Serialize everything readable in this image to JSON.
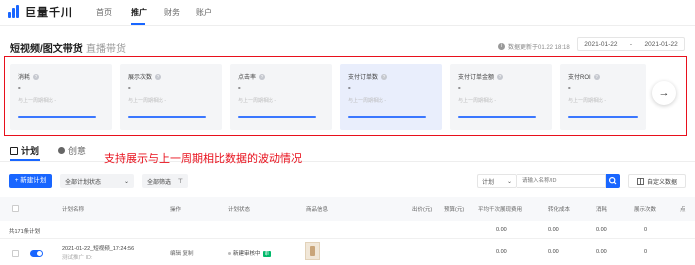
{
  "nav": {
    "logo_text": "巨量千川",
    "items": [
      {
        "label": "首页",
        "active": false
      },
      {
        "label": "推广",
        "active": true
      },
      {
        "label": "财务",
        "active": false
      },
      {
        "label": "账户",
        "active": false
      }
    ]
  },
  "content_tabs": {
    "active": "短视频/图文带货",
    "inactive": "直播带货"
  },
  "data_updated": "数据更新于01.22 18:18",
  "date_range": {
    "start": "2021-01-22",
    "sep": "-",
    "end": "2021-01-22"
  },
  "metrics": [
    {
      "title": "消耗",
      "value": "-",
      "compare": "与上一周期相比 -",
      "highlight": false
    },
    {
      "title": "展示次数",
      "value": "-",
      "compare": "与上一周期相比 -",
      "highlight": false
    },
    {
      "title": "点击率",
      "value": "-",
      "compare": "与上一周期相比 -",
      "highlight": false
    },
    {
      "title": "支付订单数",
      "value": "-",
      "compare": "与上一周期相比 -",
      "highlight": true
    },
    {
      "title": "支付订单金额",
      "value": "-",
      "compare": "与上一周期相比 -",
      "highlight": false
    },
    {
      "title": "支付ROI",
      "value": "-",
      "compare": "与上一周期相比 -",
      "highlight": false
    }
  ],
  "metrics_next": "→",
  "plan_tabs": {
    "active": "计划",
    "inactive": "创意"
  },
  "annotation": "支持展示与上一周期相比数据的波动情况",
  "toolbar": {
    "new_plan": "+ 新建计划",
    "status_select": "全部计划状态",
    "status_chevron": "⌄",
    "filter": "全部筛选",
    "filter_icon": "⊤",
    "search_type": "计划",
    "search_chevron": "⌄",
    "search_placeholder": "请输入名称/ID",
    "custom_columns": "自定义数据"
  },
  "table": {
    "headers": [
      "计划名称",
      "操作",
      "计划状态",
      "商品信息",
      "出价(元)",
      "预算(元)",
      "平均千次展现费用",
      "转化成本",
      "消耗",
      "展示次数",
      "点"
    ],
    "totals_label": "共171条计划",
    "totals": [
      "0.00",
      "0.00",
      "0.00",
      "0"
    ],
    "rows": [
      {
        "name": "2021-01-22_短视频_17:24:56",
        "sub": "测试推广  ID:",
        "actions": "编辑   复制",
        "status": "新建审核中",
        "status_tag": "审",
        "values": [
          "0.00",
          "0.00",
          "0.00",
          "0"
        ],
        "on": true
      }
    ]
  }
}
